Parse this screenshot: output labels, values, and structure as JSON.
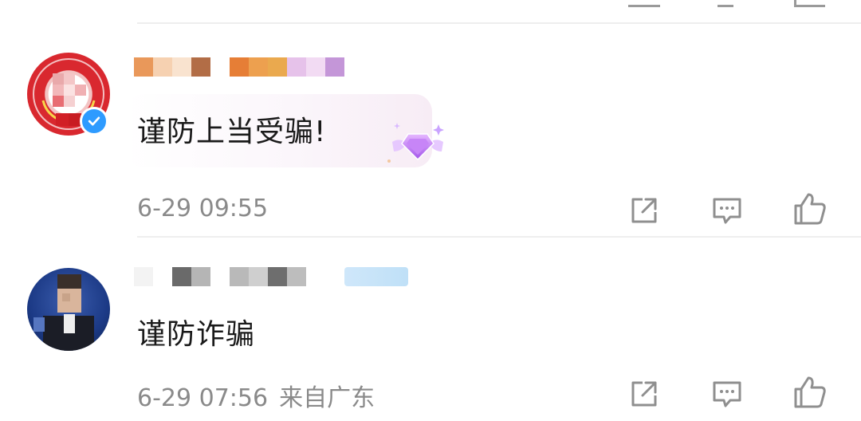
{
  "comments": [
    {
      "text": "谨防上当受骗!",
      "time": "6-29 09:55",
      "location": "",
      "avatar_icon": "government-seal-avatar",
      "verified_badge": "verified-check-icon",
      "decoration_icon": "purple-gem-icon"
    },
    {
      "text": "谨防诈骗",
      "time": "6-29 07:56",
      "location": "来自广东",
      "avatar_icon": "person-photo-avatar"
    }
  ],
  "actions": {
    "share_icon": "share-icon",
    "comment_icon": "comment-icon",
    "like_icon": "thumbs-up-icon"
  },
  "colors": {
    "meta_text": "#8a8a8a",
    "main_text": "#1a1a1a",
    "divider": "#eeeeee",
    "verified_blue": "#2e9bff",
    "gem_purple": "#b467f0"
  }
}
